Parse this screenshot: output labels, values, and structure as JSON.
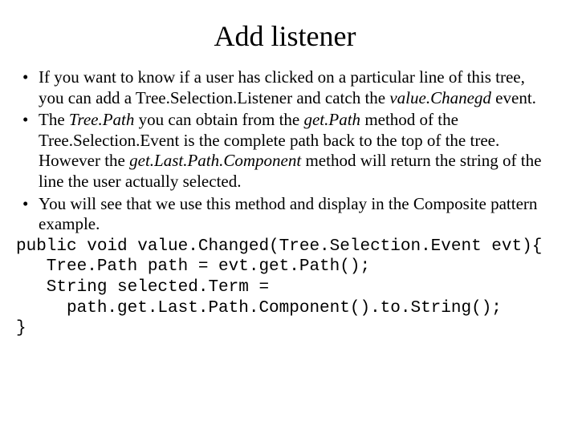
{
  "title": "Add listener",
  "bullets": {
    "b1_a": "If you want to know if a user has clicked on a particular line of this tree, you can add a Tree.Selection.Listener and catch the ",
    "b1_i": "value.Chanegd",
    "b1_b": " event.",
    "b2_a": "The ",
    "b2_i1": "Tree.Path",
    "b2_b": " you can obtain from the ",
    "b2_i2": "get.Path",
    "b2_c": " method of the Tree.Selection.Event is the complete path back to the top of the tree. However the ",
    "b2_i3": "get.Last.Path.Component",
    "b2_d": " method will return the string of the line the user actually selected.",
    "b3": "You will see that we use this method and display in the Composite pattern example."
  },
  "code": {
    "l1": "public void value.Changed(Tree.Selection.Event evt){",
    "l2": "   Tree.Path path = evt.get.Path();",
    "l3": "   String selected.Term =",
    "l4": "     path.get.Last.Path.Component().to.String();",
    "l5": "}"
  }
}
